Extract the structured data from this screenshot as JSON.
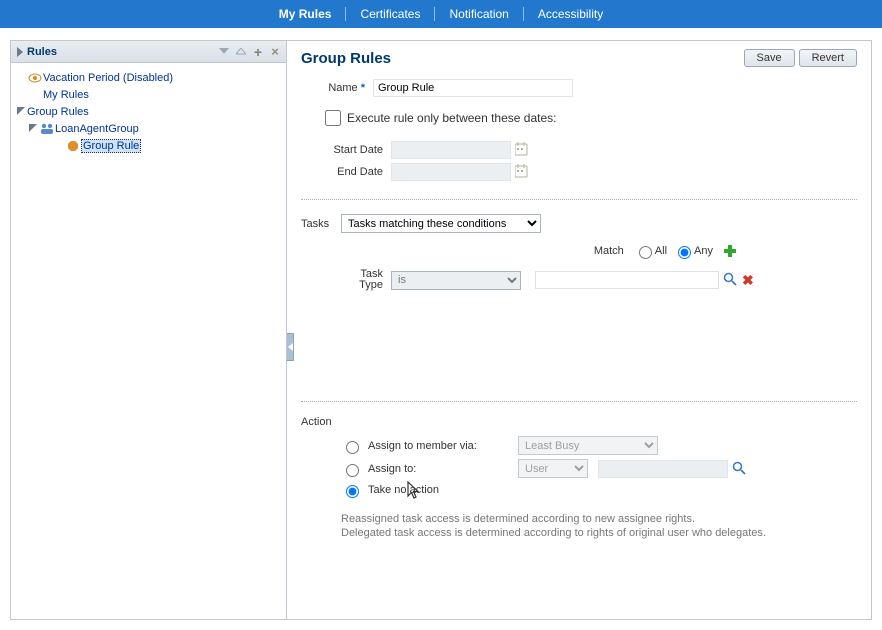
{
  "topnav": {
    "items": [
      "My Rules",
      "Certificates",
      "Notification",
      "Accessibility"
    ],
    "active": 0
  },
  "sidebar": {
    "title": "Rules",
    "tree": {
      "vacation": "Vacation Period (Disabled)",
      "myrules": "My Rules",
      "grouprules": "Group Rules",
      "loangroup": "LoanAgentGroup",
      "grouprule": "Group Rule"
    }
  },
  "header": {
    "title": "Group Rules",
    "save": "Save",
    "revert": "Revert"
  },
  "form": {
    "name_label": "Name",
    "name_value": "Group Rule",
    "execute_only": "Execute rule only between these dates:",
    "start_date": "Start Date",
    "end_date": "End Date"
  },
  "tasks": {
    "label": "Tasks",
    "select_value": "Tasks matching these conditions",
    "match_label": "Match",
    "match_all": "All",
    "match_any": "Any",
    "match_selected": "any",
    "condition": {
      "attr_label": "Task Type",
      "op": "is",
      "value": ""
    }
  },
  "action": {
    "label": "Action",
    "opt_member": "Assign to member via:",
    "member_method": "Least Busy",
    "opt_assign": "Assign to:",
    "assign_type": "User",
    "assign_value": "",
    "opt_none": "Take no action",
    "selected": "none",
    "help1": "Reassigned task access is determined according to new assignee rights.",
    "help2": "Delegated task access is determined according to rights of original user who delegates."
  }
}
